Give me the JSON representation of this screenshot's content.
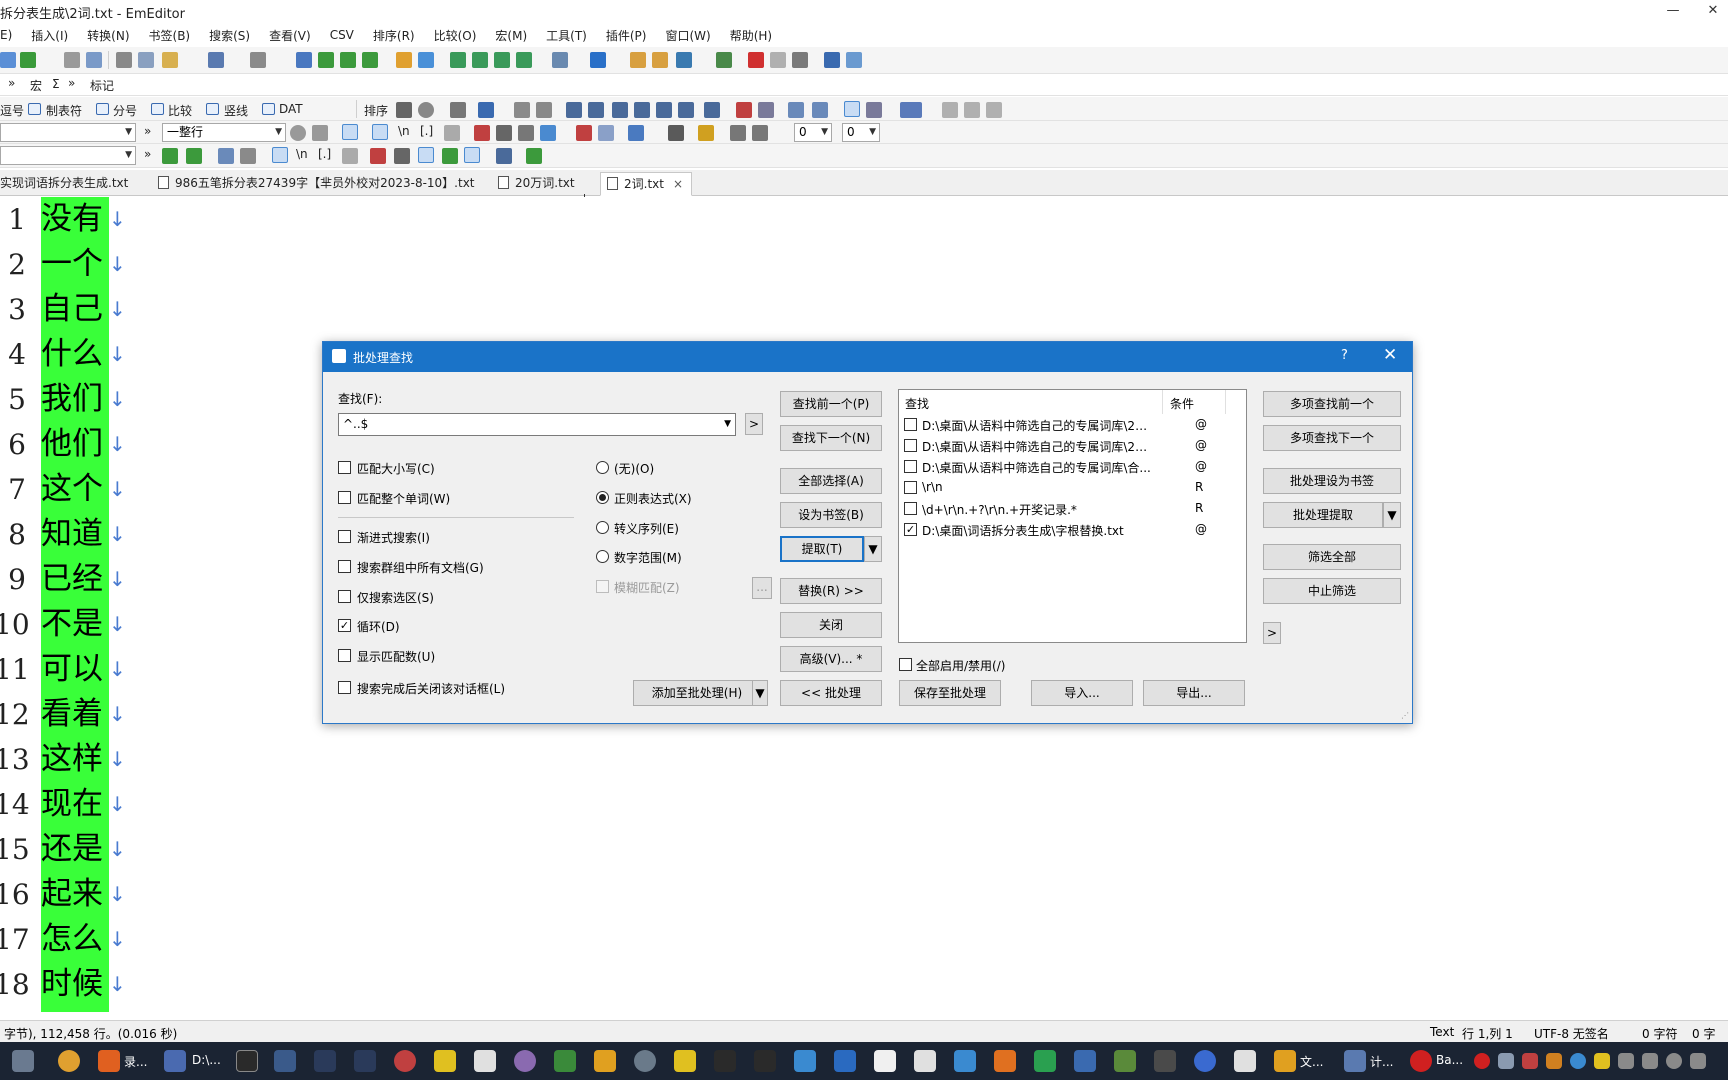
{
  "window": {
    "title": "拆分表生成\\2词.txt - EmEditor",
    "minimize": "—",
    "close": "✕"
  },
  "menu": [
    "E)",
    "插入(I)",
    "转换(N)",
    "书签(B)",
    "搜索(S)",
    "查看(V)",
    "CSV",
    "排序(R)",
    "比较(O)",
    "宏(M)",
    "工具(T)",
    "插件(P)",
    "窗口(W)",
    "帮助(H)"
  ],
  "toolbar_row2": {
    "chevron": "»",
    "macro": "宏",
    "sigma": "Σ",
    "chevron2": "»",
    "mark": "标记"
  },
  "toolbar_row3": {
    "items": [
      "逗号",
      "制表符",
      "分号",
      "比较",
      "竖线",
      "DAT"
    ],
    "sort": "排序"
  },
  "toolbar_row4": {
    "line_mode": "一整行",
    "combo_a": "0",
    "combo_b": "0"
  },
  "toolbar_row5": {
    "newline": "\\n",
    "bracket": "[.]",
    "newline2": "\\n",
    "bracket2": "[.]"
  },
  "tabs": [
    {
      "label": "实现词语拆分表生成.txt"
    },
    {
      "label": "986五笔拆分表27439字【芈员外校对2023-8-10】.txt"
    },
    {
      "label": "20万词.txt"
    },
    {
      "label": "2词.txt",
      "close": "×"
    }
  ],
  "editor": {
    "lines": [
      "没有",
      "一个",
      "自己",
      "什么",
      "我们",
      "他们",
      "这个",
      "知道",
      "已经",
      "不是",
      "可以",
      "看着",
      "这样",
      "现在",
      "还是",
      "起来",
      "怎么",
      "时候"
    ],
    "line_numbers": [
      "1",
      "2",
      "3",
      "4",
      "5",
      "6",
      "7",
      "8",
      "9",
      "10",
      "11",
      "12",
      "13",
      "14",
      "15",
      "16",
      "17",
      "18"
    ],
    "eol_mark": "↓",
    "highlight_color": "#39ff39"
  },
  "dialog": {
    "title": "批处理查找",
    "help": "?",
    "close": "✕",
    "find_label": "查找(F):",
    "find_value": "^..$",
    "expand": ">",
    "options_left": [
      {
        "label": "匹配大小写(C)",
        "checked": false
      },
      {
        "label": "匹配整个单词(W)",
        "checked": false
      },
      {
        "label": "渐进式搜索(I)",
        "checked": false
      },
      {
        "label": "搜索群组中所有文档(G)",
        "checked": false
      },
      {
        "label": "仅搜索选区(S)",
        "checked": false
      },
      {
        "label": "循环(D)",
        "checked": true
      },
      {
        "label": "显示匹配数(U)",
        "checked": false
      },
      {
        "label": "搜索完成后关闭该对话框(L)",
        "checked": false
      }
    ],
    "options_mode": [
      {
        "label": "(无)(O)",
        "selected": false
      },
      {
        "label": "正则表达式(X)",
        "selected": true
      },
      {
        "label": "转义序列(E)",
        "selected": false
      },
      {
        "label": "数字范围(M)",
        "selected": false
      }
    ],
    "fuzzy": "模糊匹配(Z)",
    "fuzzy_btn": "...",
    "add_to_batch": "添加至批处理(H)",
    "buttons_mid": {
      "find_prev": "查找前一个(P)",
      "find_next": "查找下一个(N)",
      "select_all": "全部选择(A)",
      "bookmark": "设为书签(B)",
      "extract": "提取(T)",
      "replace": "替换(R) >>",
      "close": "关闭",
      "advanced": "高级(V)... *",
      "batch": "<< 批处理"
    },
    "list": {
      "col_find": "查找",
      "col_cond": "条件",
      "rows": [
        {
          "pattern": "D:\\桌面\\从语料中筛选自己的专属词库\\2词....",
          "cond": "@",
          "checked": false
        },
        {
          "pattern": "D:\\桌面\\从语料中筛选自己的专属词库\\2词....",
          "cond": "@",
          "checked": false
        },
        {
          "pattern": "D:\\桌面\\从语料中筛选自己的专属词库\\合...",
          "cond": "@",
          "checked": false
        },
        {
          "pattern": "\\r\\n",
          "cond": "R",
          "checked": false
        },
        {
          "pattern": "\\d+\\r\\n.+?\\r\\n.+开奖记录.*",
          "cond": "R",
          "checked": false
        },
        {
          "pattern": "D:\\桌面\\词语拆分表生成\\字根替换.txt",
          "cond": "@",
          "checked": true
        }
      ]
    },
    "enable_all": "全部启用/禁用(/)",
    "save_batch": "保存至批处理",
    "import": "导入...",
    "export": "导出...",
    "buttons_right": {
      "multi_prev": "多项查找前一个",
      "multi_next": "多项查找下一个",
      "batch_bookmark": "批处理设为书签",
      "batch_extract": "批处理提取",
      "filter_all": "筛选全部",
      "stop_filter": "中止筛选",
      "more": ">"
    }
  },
  "statusbar": {
    "left": "字节), 112,458 行。(0.016 秒)",
    "type": "Text",
    "pos": "行 1,列 1",
    "enc": "UTF-8 无签名",
    "chars": "0 字符",
    "sel": "0 字"
  },
  "taskbar": {
    "search": "录...",
    "emeditor": "D:\\...",
    "explorer": "文...",
    "calc": "计...",
    "app": "Ba..."
  }
}
